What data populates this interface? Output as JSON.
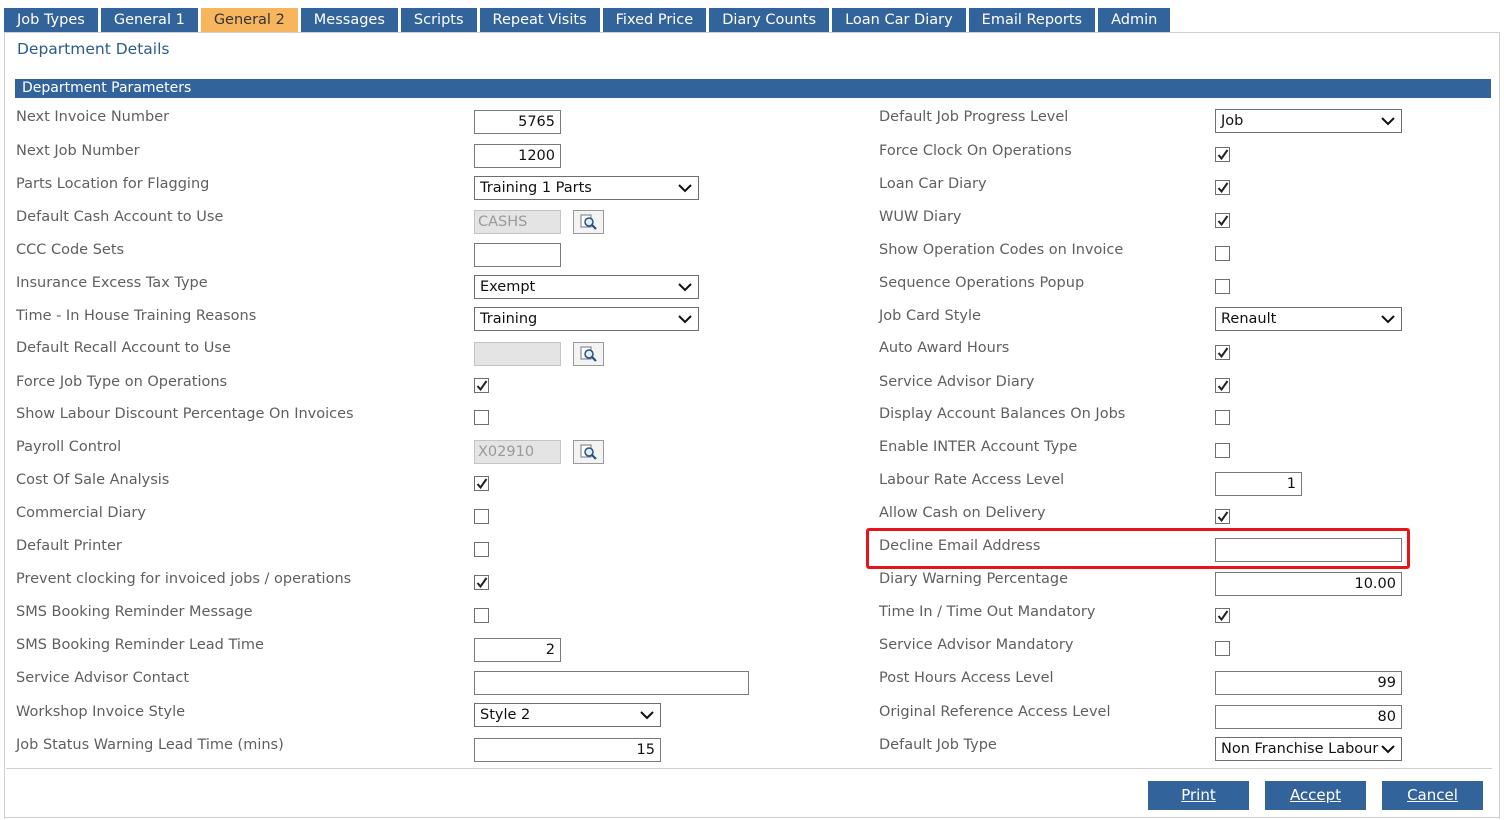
{
  "tabs": [
    "Job Types",
    "General 1",
    "General 2",
    "Messages",
    "Scripts",
    "Repeat Visits",
    "Fixed Price",
    "Diary Counts",
    "Loan Car Diary",
    "Email Reports",
    "Admin"
  ],
  "active_tab": "General 2",
  "page_title": "Department Details",
  "section_title": "Department Parameters",
  "left": {
    "next_invoice_number": {
      "label": "Next Invoice Number",
      "value": "5765"
    },
    "next_job_number": {
      "label": "Next Job Number",
      "value": "1200"
    },
    "parts_location": {
      "label": "Parts Location for Flagging",
      "value": "Training 1 Parts"
    },
    "default_cash_account": {
      "label": "Default Cash Account to Use",
      "value": "CASHS"
    },
    "ccc_code_sets": {
      "label": "CCC Code Sets",
      "value": ""
    },
    "insurance_excess_tax": {
      "label": "Insurance Excess Tax Type",
      "value": "Exempt"
    },
    "in_house_training": {
      "label": "Time - In House Training Reasons",
      "value": "Training"
    },
    "default_recall_account": {
      "label": "Default Recall Account to Use",
      "value": ""
    },
    "force_job_type": {
      "label": "Force Job Type on Operations",
      "checked": true
    },
    "show_labour_discount": {
      "label": "Show Labour Discount Percentage On Invoices",
      "checked": false
    },
    "payroll_control": {
      "label": "Payroll Control",
      "value": "X02910"
    },
    "cost_of_sale": {
      "label": "Cost Of Sale Analysis",
      "checked": true
    },
    "commercial_diary": {
      "label": "Commercial Diary",
      "checked": false
    },
    "default_printer": {
      "label": "Default Printer",
      "checked": false
    },
    "prevent_clocking": {
      "label": "Prevent clocking for invoiced jobs / operations",
      "checked": true
    },
    "sms_reminder_message": {
      "label": "SMS Booking Reminder Message",
      "checked": false
    },
    "sms_reminder_lead": {
      "label": "SMS Booking Reminder Lead Time",
      "value": "2"
    },
    "service_advisor_contact": {
      "label": "Service Advisor Contact",
      "value": ""
    },
    "workshop_invoice_style": {
      "label": "Workshop Invoice Style",
      "value": "Style 2"
    },
    "job_status_warning": {
      "label": "Job Status Warning Lead Time (mins)",
      "value": "15"
    }
  },
  "right": {
    "default_job_progress": {
      "label": "Default Job Progress Level",
      "value": "Job"
    },
    "force_clock_on": {
      "label": "Force Clock On Operations",
      "checked": true
    },
    "loan_car_diary": {
      "label": "Loan Car Diary",
      "checked": true
    },
    "wuw_diary": {
      "label": "WUW Diary",
      "checked": true
    },
    "show_op_codes": {
      "label": "Show Operation Codes on Invoice",
      "checked": false
    },
    "sequence_ops_popup": {
      "label": "Sequence Operations Popup",
      "checked": false
    },
    "job_card_style": {
      "label": "Job Card Style",
      "value": "Renault"
    },
    "auto_award_hours": {
      "label": "Auto Award Hours",
      "checked": true
    },
    "service_advisor_diary": {
      "label": "Service Advisor Diary",
      "checked": true
    },
    "display_account_balances": {
      "label": "Display Account Balances On Jobs",
      "checked": false
    },
    "enable_inter_account": {
      "label": "Enable INTER Account Type",
      "checked": false
    },
    "labour_rate_access": {
      "label": "Labour Rate Access Level",
      "value": "1"
    },
    "allow_cod": {
      "label": "Allow Cash on Delivery",
      "checked": true
    },
    "decline_email": {
      "label": "Decline Email Address",
      "value": ""
    },
    "diary_warning_pct": {
      "label": "Diary Warning Percentage",
      "value": "10.00"
    },
    "time_in_out_mandatory": {
      "label": "Time In / Time Out Mandatory",
      "checked": true
    },
    "service_advisor_mandatory": {
      "label": "Service Advisor Mandatory",
      "checked": false
    },
    "post_hours_access": {
      "label": "Post Hours Access Level",
      "value": "99"
    },
    "original_ref_access": {
      "label": "Original Reference Access Level",
      "value": "80"
    },
    "default_job_type": {
      "label": "Default Job Type",
      "value": "Non Franchise Labour"
    }
  },
  "buttons": {
    "print": "Print",
    "accept": "Accept",
    "cancel": "Cancel"
  },
  "colors": {
    "tab_bg": "#33639b",
    "tab_active_bg": "#f7b55d",
    "highlight_border": "#e8141c"
  }
}
